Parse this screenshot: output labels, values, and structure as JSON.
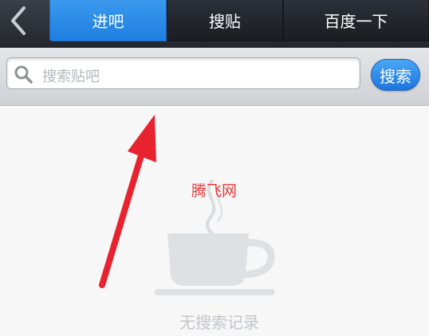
{
  "header": {
    "tabs": [
      {
        "label": "进吧",
        "active": true
      },
      {
        "label": "搜贴",
        "active": false
      },
      {
        "label": "百度一下",
        "active": false
      }
    ]
  },
  "search": {
    "placeholder": "搜索贴吧",
    "button_label": "搜索"
  },
  "empty_state": {
    "watermark": "腾飞网",
    "message": "无搜索记录"
  },
  "icons": {
    "back": "chevron-left-icon",
    "search": "magnifier-icon",
    "empty": "coffee-cup-icon",
    "annotation": "red-arrow-icon"
  },
  "colors": {
    "active_tab": "#2a8ae8",
    "topbar": "#2b2f36",
    "search_button": "#2f8cea",
    "annotation": "#e8232f"
  }
}
